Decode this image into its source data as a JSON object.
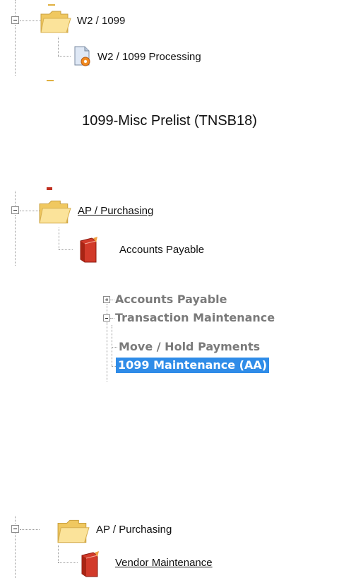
{
  "tree_w2": {
    "folder_label": "W2 / 1099",
    "child_label": "W2 / 1099 Processing"
  },
  "caption": "1099-Misc Prelist (TNSB18)",
  "tree_ap1": {
    "folder_label": "AP / Purchasing",
    "child_label": "Accounts Payable"
  },
  "menu_tree": {
    "items": [
      {
        "label": "Accounts Payable",
        "expander": "plus"
      },
      {
        "label": "Transaction Maintenance",
        "expander": "minus"
      },
      {
        "label": "Move / Hold Payments"
      },
      {
        "label": "1099 Maintenance (AA)",
        "selected": true
      }
    ]
  },
  "tree_ap2": {
    "folder_label": "AP / Purchasing",
    "child_label": "Vendor Maintenance"
  },
  "colors": {
    "selection": "#2f8ce8",
    "folder": "#f6d77a",
    "book": "#d23a2a"
  },
  "icons": [
    "folder-icon",
    "document-gear-icon",
    "book-icon",
    "expand-icon",
    "collapse-icon"
  ]
}
